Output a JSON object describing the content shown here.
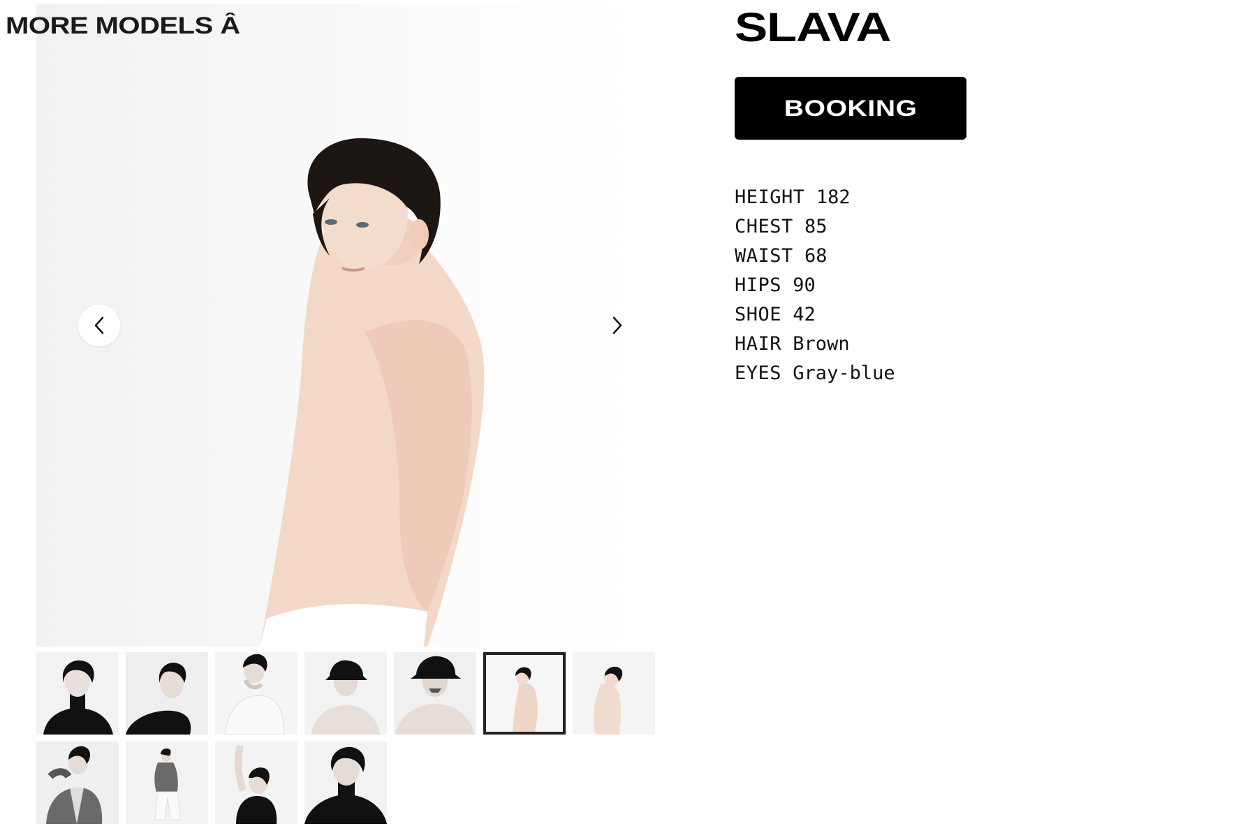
{
  "header": {
    "more_models_label": "MORE MODELS Â"
  },
  "model": {
    "name": "SLAVA",
    "booking_label": "BOOKING"
  },
  "measurements": [
    {
      "key": "HEIGHT",
      "value": "182"
    },
    {
      "key": "CHEST",
      "value": "85"
    },
    {
      "key": "WAIST",
      "value": "68"
    },
    {
      "key": "HIPS",
      "value": "90"
    },
    {
      "key": "SHOE",
      "value": "42"
    },
    {
      "key": "HAIR",
      "value": "Brown"
    },
    {
      "key": "EYES",
      "value": "Gray-blue"
    }
  ],
  "gallery": {
    "active_index": 5,
    "icons": {
      "prev": "chevron-left-icon",
      "next": "chevron-right-icon"
    }
  },
  "colors": {
    "text": "#000000",
    "button_bg": "#000000",
    "button_text": "#ffffff",
    "active_thumb_border": "#222222"
  }
}
